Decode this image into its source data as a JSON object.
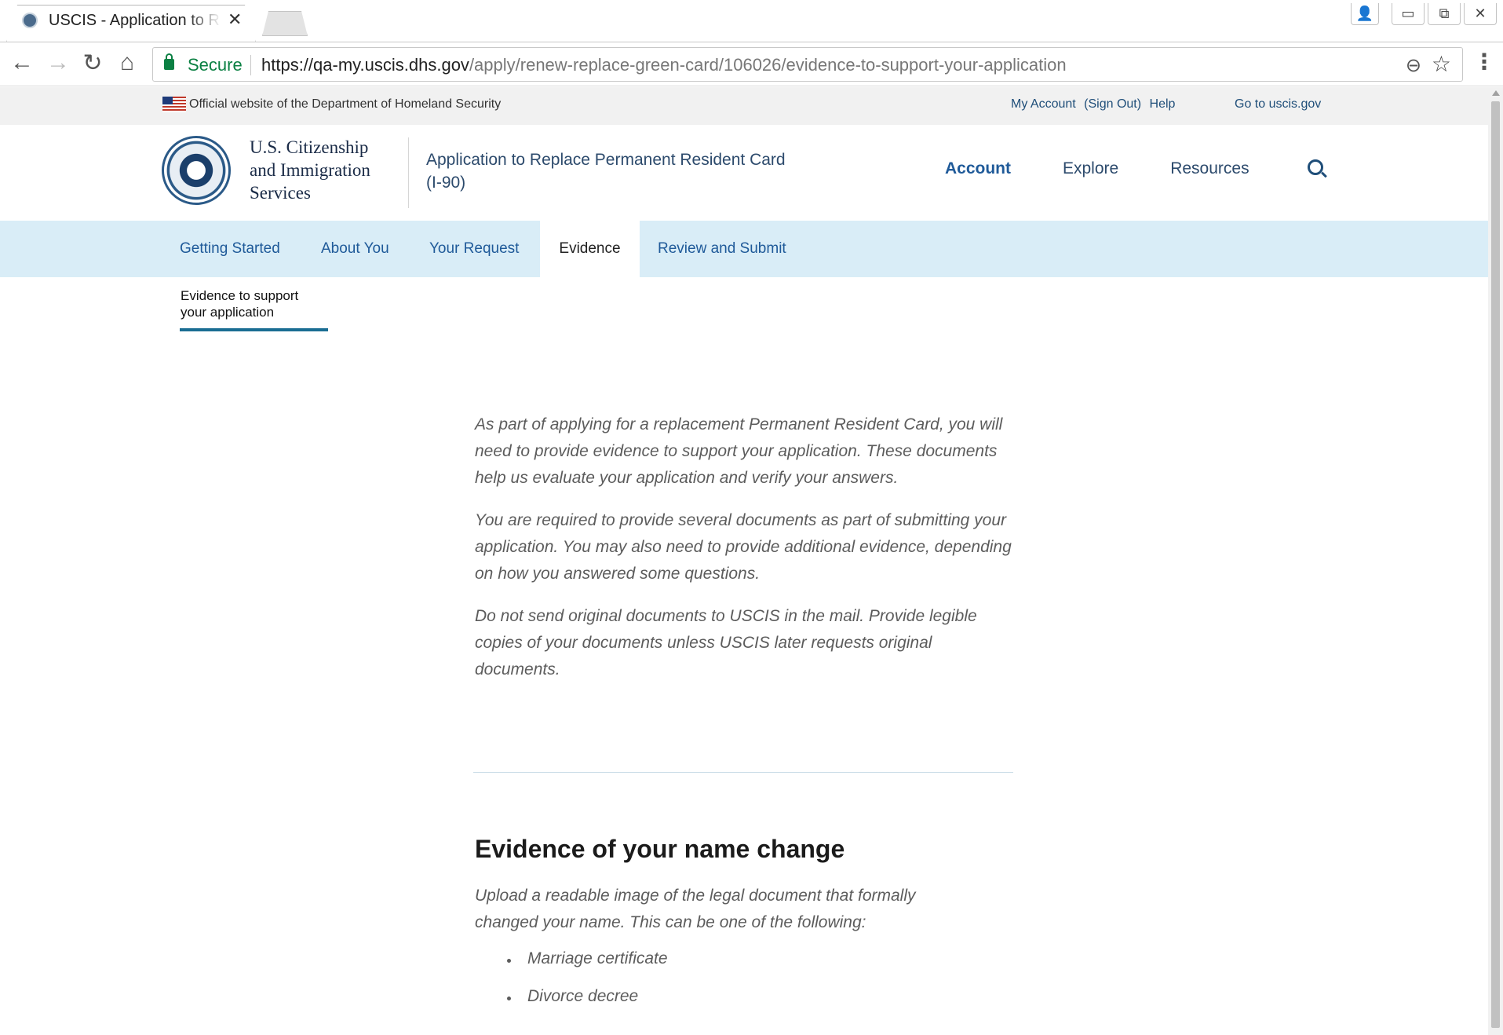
{
  "browser": {
    "tab_title": "USCIS - Application to Re",
    "tab_close": "✕",
    "secure_label": "Secure",
    "url_host": "https://qa-my.uscis.dhs.gov",
    "url_path": "/apply/renew-replace-green-card/106026/evidence-to-support-your-application",
    "nav_back": "←",
    "nav_forward": "→",
    "nav_reload": "↻",
    "nav_home": "⌂",
    "zoom_glyph": "⊖",
    "star_glyph": "☆",
    "menu_glyph": "⋮",
    "win_user": "👤",
    "win_min": "▭",
    "win_restore": "⧉",
    "win_close": "✕"
  },
  "govbar": {
    "official_text": "Official website of the Department of Homeland Security",
    "my_account": "My Account",
    "sign_out": "(Sign Out)",
    "help": "Help",
    "goto": "Go to uscis.gov"
  },
  "header": {
    "agency_line1": "U.S. Citizenship",
    "agency_line2": "and Immigration",
    "agency_line3": "Services",
    "app_title": "Application to Replace Permanent Resident Card (I-90)",
    "nav": [
      "Account",
      "Explore",
      "Resources"
    ]
  },
  "steps": [
    "Getting Started",
    "About You",
    "Your Request",
    "Evidence",
    "Review and Submit"
  ],
  "active_step": "Evidence",
  "substep": {
    "line1": "Evidence to support",
    "line2": "your application"
  },
  "intro": [
    "As part of applying for a replacement Permanent Resident Card, you will need to provide evidence to support your application. These documents help us evaluate your application and verify your answers.",
    "You are required to provide several documents as part of submitting your application. You may also need to provide additional evidence, depending on how you answered some questions.",
    "Do not send original documents to USCIS in the mail. Provide legible copies of your documents unless USCIS later requests original documents."
  ],
  "section": {
    "title": "Evidence of your name change",
    "description": "Upload a readable image of the legal document that formally changed your name. This can be one of the following:",
    "items": [
      "Marriage certificate",
      "Divorce decree"
    ]
  },
  "colors": {
    "accent": "#1a6d93",
    "stepbar": "#d9edf7",
    "link": "#1f5a99",
    "secure": "#0b8043"
  }
}
